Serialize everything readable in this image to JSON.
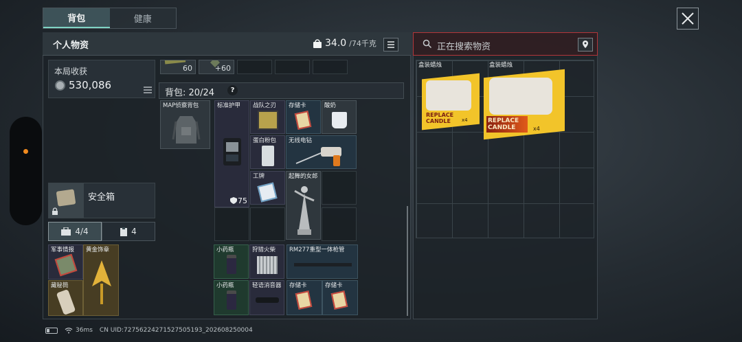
{
  "tabs": [
    {
      "label": "背包",
      "active": true
    },
    {
      "label": "健康",
      "active": false
    }
  ],
  "panel": {
    "title": "个人物资",
    "weight_current": "34.0",
    "weight_max": "/74千克"
  },
  "search": {
    "placeholder": "正在搜索物资"
  },
  "earnings": {
    "label": "本局收获",
    "value": "530,086"
  },
  "top_row": [
    {
      "count": "60"
    },
    {
      "count": "+60"
    }
  ],
  "backpack": {
    "label": "背包:",
    "capacity": "20/24",
    "help": "?",
    "bag_name": "MAP侦察背包"
  },
  "items": {
    "armor": {
      "label": "标准护甲",
      "durability": "75"
    },
    "blade": {
      "label": "战队之刃"
    },
    "card1": {
      "label": "存储卡"
    },
    "yogurt": {
      "label": "酸奶"
    },
    "protein": {
      "label": "蛋白粉包"
    },
    "drill": {
      "label": "无线电钻"
    },
    "badge": {
      "label": "工牌"
    },
    "dancer": {
      "label": "起舞的女郎"
    },
    "med1": {
      "label": "小药瓶"
    },
    "match": {
      "label": "狩猎火柴"
    },
    "rail": {
      "label": "RM277重型一体枪管"
    },
    "med2": {
      "label": "小药瓶"
    },
    "silencer": {
      "label": "轻语消音器"
    },
    "card2": {
      "label": "存储卡"
    },
    "card3": {
      "label": "存储卡"
    }
  },
  "safe": {
    "label": "安全箱",
    "tab1": "4/4",
    "tab2": "4",
    "items": [
      {
        "label": "军事情报"
      },
      {
        "label": "黄金饰章"
      },
      {
        "label": "藏秘筒"
      }
    ]
  },
  "loot": [
    {
      "label": "盒装蜡烛"
    },
    {
      "label": "盒装蜡烛"
    }
  ],
  "candle_box_text": {
    "brand": "REPLACE",
    "product": "CANDLE",
    "quantity": "x4"
  },
  "footer": {
    "ping": "36ms",
    "uid": "CN UID:72756224271527505193_202608250004"
  },
  "colors": {
    "accent": "#7fd3c4",
    "search_border": "#b4363a",
    "indicator": "#f08a1e"
  }
}
